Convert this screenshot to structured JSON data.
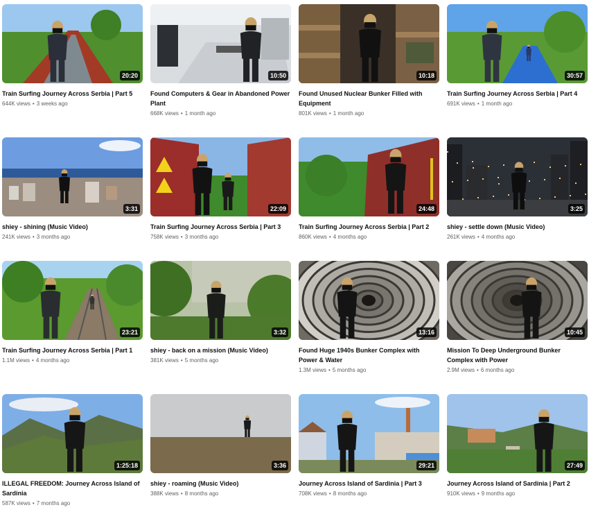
{
  "videos": [
    {
      "title": "Train Surfing Journey Across Serbia | Part 5",
      "views": "644K views",
      "age": "3 weeks ago",
      "duration": "20:20",
      "scene": "train-red",
      "sky": "#9cc7ef",
      "ground": "#4f8f2e"
    },
    {
      "title": "Found Computers & Gear in Abandoned Power Plant",
      "views": "668K views",
      "age": "1 month ago",
      "duration": "10:50",
      "scene": "office",
      "sky": "#d9dde0",
      "ground": "#8a8f93"
    },
    {
      "title": "Found Unused Nuclear Bunker Filled with Equipment",
      "views": "801K views",
      "age": "1 month ago",
      "duration": "10:18",
      "scene": "bunker-wood",
      "sky": "#6b5a44",
      "ground": "#3a3027"
    },
    {
      "title": "Train Surfing Journey Across Serbia | Part 4",
      "views": "691K views",
      "age": "1 month ago",
      "duration": "30:57",
      "scene": "train-blue",
      "sky": "#5fa3e8",
      "ground": "#5a9a35"
    },
    {
      "title": "shiey - shining (Music Video)",
      "views": "241K views",
      "age": "3 months ago",
      "duration": "3:31",
      "scene": "city-sea",
      "sky": "#6d9de0",
      "ground": "#9b8d80"
    },
    {
      "title": "Train Surfing Journey Across Serbia | Part 3",
      "views": "758K views",
      "age": "3 months ago",
      "duration": "22:09",
      "scene": "wagon-red",
      "sky": "#8ab6e6",
      "ground": "#9b2d2a"
    },
    {
      "title": "Train Surfing Journey Across Serbia | Part 2",
      "views": "860K views",
      "age": "4 months ago",
      "duration": "24:48",
      "scene": "wagon-forest",
      "sky": "#8fbde8",
      "ground": "#3f8a2c"
    },
    {
      "title": "shiey - settle down (Music Video)",
      "views": "261K views",
      "age": "4 months ago",
      "duration": "3:25",
      "scene": "night-city",
      "sky": "#2b2f36",
      "ground": "#3b3d40"
    },
    {
      "title": "Train Surfing Journey Across Serbia | Part 1",
      "views": "1.1M views",
      "age": "4 months ago",
      "duration": "23:21",
      "scene": "rails-forest",
      "sky": "#a7d3ef",
      "ground": "#5a9a2f"
    },
    {
      "title": "shiey - back on a mission (Music Video)",
      "views": "381K views",
      "age": "5 months ago",
      "duration": "3:32",
      "scene": "bushes",
      "sky": "#b8c2a6",
      "ground": "#4e7a2e"
    },
    {
      "title": "Found Huge 1940s Bunker Complex with Power & Water",
      "views": "1.3M views",
      "age": "5 months ago",
      "duration": "13:16",
      "scene": "tunnel-light",
      "sky": "#b9b5ad",
      "ground": "#6f6a62"
    },
    {
      "title": "Mission To Deep Underground Bunker Complex with Power",
      "views": "2.9M views",
      "age": "6 months ago",
      "duration": "10:45",
      "scene": "tunnel-dark",
      "sky": "#8d8982",
      "ground": "#4a4742"
    },
    {
      "title": "ILLEGAL FREEDOM: Journey Across Island of Sardinia",
      "views": "587K views",
      "age": "7 months ago",
      "duration": "1:25:18",
      "scene": "mountains",
      "sky": "#7eaee6",
      "ground": "#5d7a3a"
    },
    {
      "title": "shiey - roaming (Music Video)",
      "views": "388K views",
      "age": "8 months ago",
      "duration": "3:36",
      "scene": "foggy-hill",
      "sky": "#c9cbcc",
      "ground": "#7b6a4c"
    },
    {
      "title": "Journey Across Island of Sardinia | Part 3",
      "views": "708K views",
      "age": "8 months ago",
      "duration": "29:21",
      "scene": "village",
      "sky": "#8ebde9",
      "ground": "#7a8a5a"
    },
    {
      "title": "Journey Across Island of Sardinia | Part 2",
      "views": "910K views",
      "age": "9 months ago",
      "duration": "27:49",
      "scene": "ruins-valley",
      "sky": "#9fc3ea",
      "ground": "#4f7f35"
    }
  ]
}
